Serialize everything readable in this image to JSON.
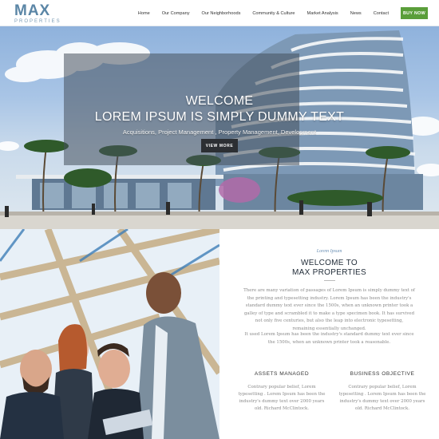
{
  "header": {
    "logo_main": "MAX",
    "logo_sub": "PROPERTIES",
    "nav": [
      {
        "label": "Home"
      },
      {
        "label": "Our Company"
      },
      {
        "label": "Our Neighborhoods"
      },
      {
        "label": "Community & Culture"
      },
      {
        "label": "Market Analysis"
      },
      {
        "label": "News"
      },
      {
        "label": "Contact"
      }
    ],
    "buy_now": "BUY NOW"
  },
  "hero": {
    "line1": "WELCOME",
    "line2": "LOREM IPSUM IS SIMPLY DUMMY TEXT",
    "subtitle": "Acquisitions, Project Management , Property Management, Development",
    "button": "VIEW MORE"
  },
  "about": {
    "kicker": "Lorem Ipsum",
    "title_line1": "WELCOME TO",
    "title_line2": "MAX PROPERTIES",
    "paragraph1": "There are many variation of passages of Lorem Ipsum is simply dummy text of the printing and typesetting industry. Lorem Ipsum has been the industry's standard dummy text ever since the 1500s, when an unknown printer took a galley of type and scrambled it to make a type specimen book. It has survived not only five centuries, but also the leap into electronic typesetting, remaining essentially unchanged.",
    "paragraph2": "It used Lorem Ipsum has been the industry's standard dummy text ever since the 1500s, when an unknown printer took a reasonable.",
    "assets": {
      "title": "ASSETS MANAGED",
      "text": "Contrary popular belief, Lorem typesetting . Lorem Ipsum has been the industry's dummy text over 2000 years old. Richard McClintock."
    },
    "objective": {
      "title": "BUSINESS OBJECTIVE",
      "text": "Contrary popular belief, Lorem typesetting . Lorem Ipsum has been the industry's dummy text over 2000 years old. Richard McClintock."
    }
  },
  "colors": {
    "accent": "#5b86a6",
    "buy_button": "#5a9e3a",
    "overlay": "#46505c",
    "view_more": "#2c2f33"
  }
}
